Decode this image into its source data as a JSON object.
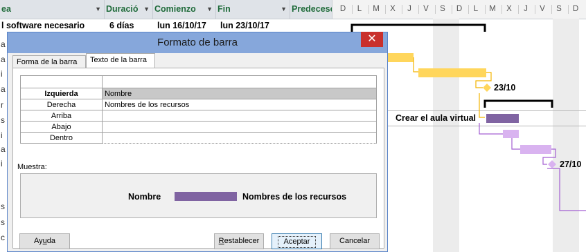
{
  "table": {
    "columns": [
      {
        "label": "ea"
      },
      {
        "label": "Duració"
      },
      {
        "label": "Comienzo"
      },
      {
        "label": "Fin"
      },
      {
        "label": "Predecesor"
      }
    ],
    "row1": {
      "name": "l software necesario",
      "duration": "6 días",
      "start": "lun 16/10/17",
      "end": "lun 23/10/17"
    },
    "left_fragments": [
      "a",
      "a",
      "i",
      "a",
      "r",
      "s",
      "i",
      "a",
      "i",
      "s",
      "s",
      "c"
    ]
  },
  "timescale": {
    "days": [
      "D",
      "L",
      "M",
      "X",
      "J",
      "V",
      "S",
      "D",
      "L",
      "M",
      "X",
      "J",
      "V",
      "S",
      "D"
    ]
  },
  "gantt": {
    "milestone1_label": "23/10",
    "task_label": "Crear el aula virtual",
    "milestone2_label": "27/10",
    "colors": {
      "yellow_bar": "#ffd65c",
      "purple_task": "#8064a2",
      "lilac_bar": "#d9b3f0",
      "milestone_yellow": "#ffd65c",
      "milestone_lilac": "#d9b3f0",
      "link_yellow": "#f4b400",
      "link_purple": "#a35fd2",
      "summary_black": "#000000"
    }
  },
  "dialog": {
    "title": "Formato de barra",
    "close_glyph": "✕",
    "tabs": [
      "Forma de la barra",
      "Texto de la barra"
    ],
    "active_tab": "Texto de la barra",
    "rows": [
      {
        "label": "Izquierda",
        "value": "Nombre",
        "selected": true
      },
      {
        "label": "Derecha",
        "value": "Nombres de los recursos",
        "selected": false
      },
      {
        "label": "Arriba",
        "value": "",
        "selected": false
      },
      {
        "label": "Abajo",
        "value": "",
        "selected": false
      },
      {
        "label": "Dentro",
        "value": "",
        "selected": false
      }
    ],
    "sample_label": "Muestra:",
    "sample_left": "Nombre",
    "sample_right": "Nombres de los recursos",
    "sample_bar_color": "#8064a2",
    "buttons": {
      "help": {
        "pre": "Ay",
        "u": "u",
        "post": "da"
      },
      "reset": {
        "pre": "",
        "u": "R",
        "post": "establecer"
      },
      "ok": "Aceptar",
      "cancel": "Cancelar"
    }
  }
}
